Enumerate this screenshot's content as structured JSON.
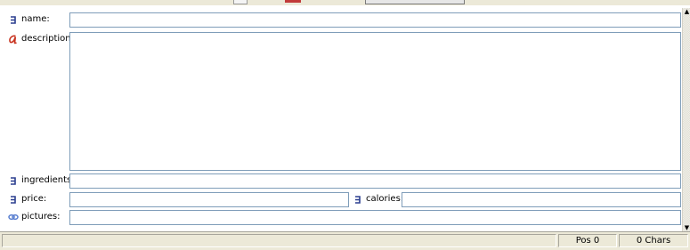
{
  "fields": {
    "name": {
      "label": "name:",
      "icon": "text-field-icon",
      "value": ""
    },
    "description": {
      "label": "description:",
      "icon": "rich-text-icon",
      "value": ""
    },
    "ingredients": {
      "label": "ingredients:",
      "icon": "text-field-icon",
      "value": ""
    },
    "price": {
      "label": "price:",
      "icon": "text-field-icon",
      "value": ""
    },
    "calories": {
      "label": "calories:",
      "icon": "text-field-icon",
      "value": ""
    },
    "pictures": {
      "label": "pictures:",
      "icon": "link-icon",
      "value": ""
    }
  },
  "status": {
    "position": "Pos 0",
    "chars": "0 Chars"
  },
  "colors": {
    "text_icon": "#2b3f8f",
    "rich_icon": "#c8321e",
    "link_icon": "#5a7fd0",
    "field_border": "#7f9db9",
    "chrome": "#ece9d8"
  }
}
